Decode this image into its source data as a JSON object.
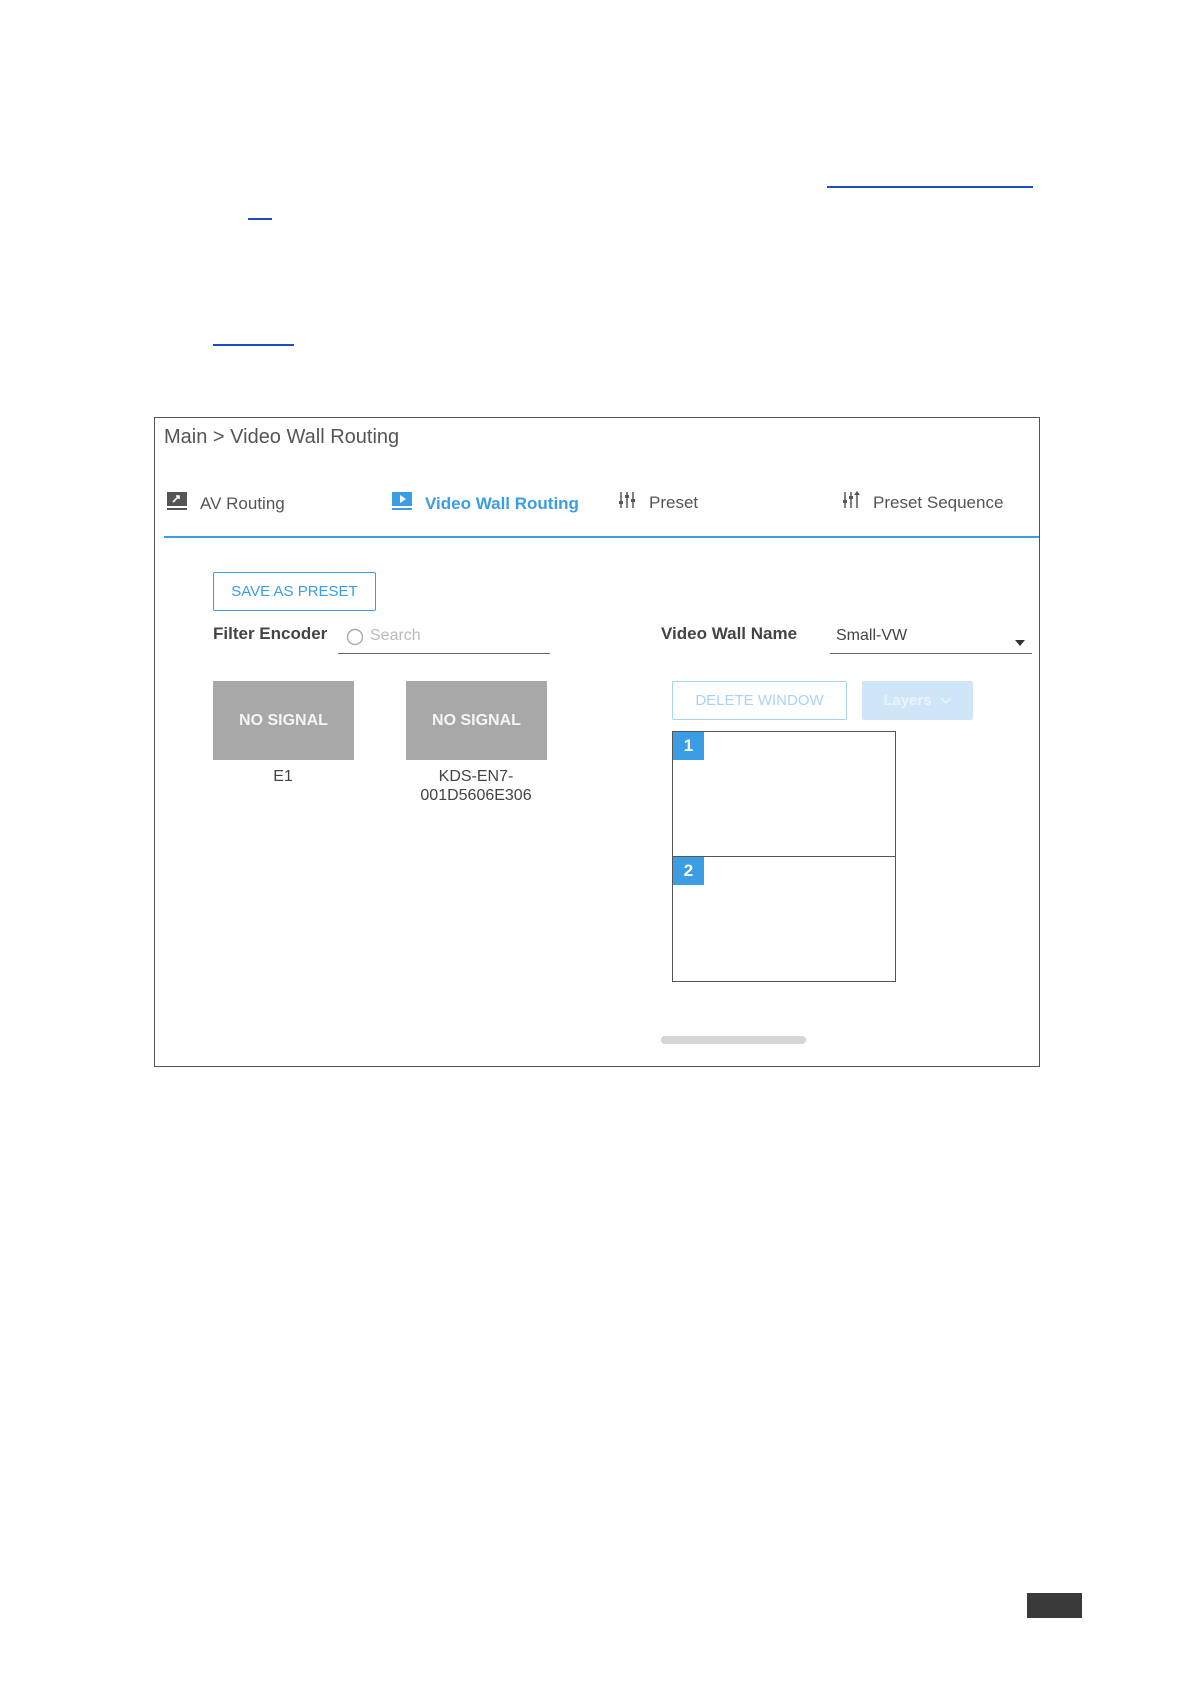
{
  "app": {
    "breadcrumb": "Main > Video Wall Routing",
    "tabs": [
      {
        "label": "AV Routing",
        "icon": "monitor-icon",
        "active": false
      },
      {
        "label": "Video Wall Routing",
        "icon": "video-wall-icon",
        "active": true
      },
      {
        "label": "Preset",
        "icon": "sliders-icon",
        "active": false
      },
      {
        "label": "Preset Sequence",
        "icon": "preset-sequence-icon",
        "active": false
      }
    ],
    "save_preset_label": "SAVE AS PRESET",
    "filter_encoder_label": "Filter Encoder",
    "search_placeholder": "Search",
    "video_wall_name_label": "Video Wall Name",
    "video_wall_name_value": "Small-VW",
    "delete_window_label": "DELETE WINDOW",
    "layers_label": "Layers",
    "encoders": [
      {
        "preview": "NO SIGNAL",
        "name": "E1"
      },
      {
        "preview": "NO SIGNAL",
        "name": "KDS-EN7-\n001D5606E306",
        "name_line1": "KDS-EN7-",
        "name_line2": "001D5606E306"
      }
    ],
    "windows": [
      {
        "number": "1"
      },
      {
        "number": "2"
      }
    ]
  },
  "colors": {
    "accent": "#3b9de4",
    "accent_disabled": "#a8d4f3",
    "thumb_bg": "#a8a8a8",
    "link": "#1a4fc4"
  }
}
